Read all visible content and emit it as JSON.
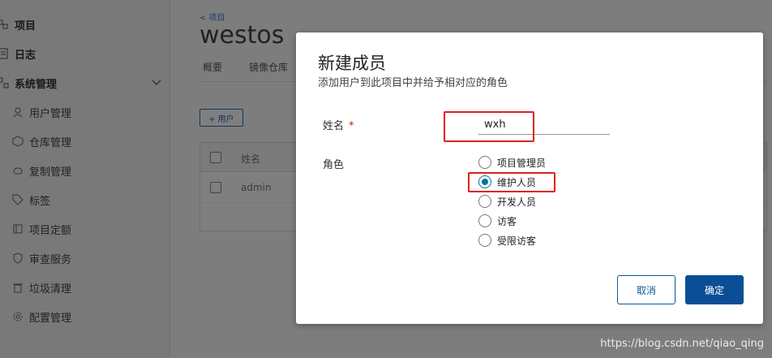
{
  "sidebar": {
    "items": [
      {
        "label": "项目",
        "icon": "projects-icon"
      },
      {
        "label": "日志",
        "icon": "logs-icon"
      },
      {
        "label": "系统管理",
        "icon": "admin-icon"
      }
    ],
    "sub_items": [
      {
        "label": "用户管理",
        "icon": "users-icon"
      },
      {
        "label": "仓库管理",
        "icon": "registry-icon"
      },
      {
        "label": "复制管理",
        "icon": "replication-icon"
      },
      {
        "label": "标签",
        "icon": "tag-icon"
      },
      {
        "label": "项目定额",
        "icon": "quota-icon"
      },
      {
        "label": "审查服务",
        "icon": "shield-icon"
      },
      {
        "label": "垃圾清理",
        "icon": "trash-icon"
      },
      {
        "label": "配置管理",
        "icon": "gear-icon"
      }
    ]
  },
  "project": {
    "back_link": "< 项目",
    "title": "westos",
    "tabs": [
      "概要",
      "镜像仓库"
    ],
    "add_user_button": "+ 用户",
    "table_header": "姓名",
    "table_rows": [
      "admin"
    ]
  },
  "modal": {
    "title": "新建成员",
    "subtitle": "添加用户到此项目中并给予相对应的角色",
    "name_label": "姓名",
    "required_mark": "*",
    "name_value": "wxh",
    "role_label": "角色",
    "roles": [
      "项目管理员",
      "维护人员",
      "开发人员",
      "访客",
      "受限访客"
    ],
    "selected_role": "维护人员",
    "cancel_label": "取消",
    "ok_label": "确定"
  },
  "watermark": "https://blog.csdn.net/qiao_qing",
  "colors": {
    "accent": "#0a4f95",
    "highlight": "#e02020",
    "radio": "#0072a3"
  }
}
